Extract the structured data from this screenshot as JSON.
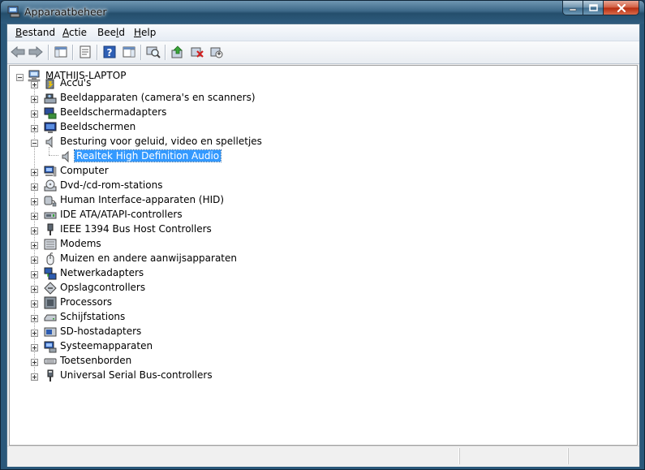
{
  "window": {
    "title": "Apparaatbeheer"
  },
  "menu": [
    {
      "accel": "B",
      "rest": "estand"
    },
    {
      "accel": "A",
      "rest": "ctie"
    },
    {
      "pre": "Bee",
      "accel": "l",
      "rest": "d"
    },
    {
      "accel": "H",
      "rest": "elp"
    }
  ],
  "toolbar": [
    "back-icon",
    "forward-icon",
    "console-tree-icon",
    "properties-icon",
    "help-icon",
    "action-pane-icon",
    "scan-hardware-icon",
    "update-driver-icon",
    "uninstall-icon",
    "disable-icon"
  ],
  "tree": {
    "root": "MATHIJS-LAPTOP",
    "items": [
      "Accu's",
      "Beeldapparaten (camera's en scanners)",
      "Beeldschermadapters",
      "Beeldschermen",
      "Besturing voor geluid, video en spelletjes",
      "Realtek High Definition Audio",
      "Computer",
      "Dvd-/cd-rom-stations",
      "Human Interface-apparaten (HID)",
      "IDE ATA/ATAPI-controllers",
      "IEEE 1394 Bus Host Controllers",
      "Modems",
      "Muizen en andere aanwijsapparaten",
      "Netwerkadapters",
      "Opslagcontrollers",
      "Processors",
      "Schijfstations",
      "SD-hostadapters",
      "Systeemapparaten",
      "Toetsenborden",
      "Universal Serial Bus-controllers"
    ]
  },
  "colors": {
    "selection": "#3399ff",
    "close": "#c8401f"
  }
}
